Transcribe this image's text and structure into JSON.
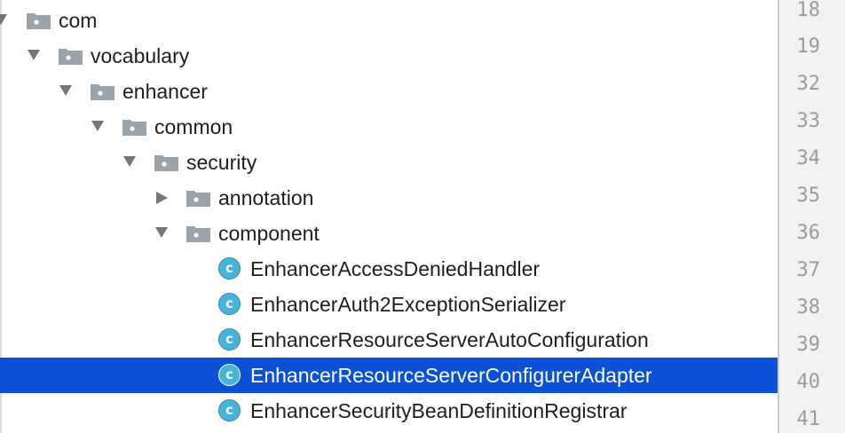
{
  "tree": {
    "rows": [
      {
        "label": "com",
        "kind": "package",
        "state": "expanded"
      },
      {
        "label": "vocabulary",
        "kind": "package",
        "state": "expanded"
      },
      {
        "label": "enhancer",
        "kind": "package",
        "state": "expanded"
      },
      {
        "label": "common",
        "kind": "package",
        "state": "expanded"
      },
      {
        "label": "security",
        "kind": "package",
        "state": "expanded"
      },
      {
        "label": "annotation",
        "kind": "package",
        "state": "collapsed"
      },
      {
        "label": "component",
        "kind": "package",
        "state": "expanded"
      },
      {
        "label": "EnhancerAccessDeniedHandler",
        "kind": "class",
        "icon_letter": "c"
      },
      {
        "label": "EnhancerAuth2ExceptionSerializer",
        "kind": "class",
        "icon_letter": "c"
      },
      {
        "label": "EnhancerResourceServerAutoConfiguration",
        "kind": "class",
        "icon_letter": "c"
      },
      {
        "label": "EnhancerResourceServerConfigurerAdapter",
        "kind": "class",
        "icon_letter": "c",
        "selected": true
      },
      {
        "label": "EnhancerSecurityBeanDefinitionRegistrar",
        "kind": "class",
        "icon_letter": "c"
      }
    ]
  },
  "gutter": {
    "line_numbers": [
      "18",
      "19",
      "32",
      "33",
      "34",
      "35",
      "36",
      "37",
      "38",
      "39",
      "40",
      "41"
    ]
  },
  "colors": {
    "selection": "#0b51d6",
    "class_icon": "#46b3d9",
    "folder_icon": "#9aa4ad",
    "gutter_background": "#f2f2f2",
    "line_number": "#9b9b9b"
  },
  "icons": {
    "package": "folder-icon",
    "class": "class-icon",
    "expanded": "triangle-down-icon",
    "collapsed": "triangle-right-icon"
  }
}
